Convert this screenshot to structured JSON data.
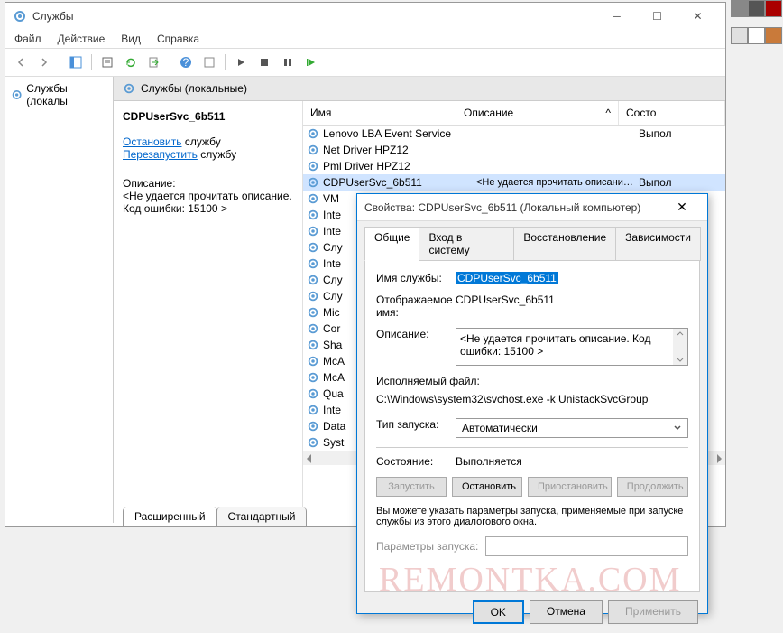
{
  "window": {
    "title": "Службы",
    "menu": {
      "file": "Файл",
      "action": "Действие",
      "view": "Вид",
      "help": "Справка"
    }
  },
  "tree": {
    "root": "Службы (локалы"
  },
  "panel_header": "Службы (локальные)",
  "detail": {
    "selected_name": "CDPUserSvc_6b511",
    "stop_link": "Остановить",
    "stop_suffix": " службу",
    "restart_link": "Перезапустить",
    "restart_suffix": " службу",
    "desc_label": "Описание:",
    "desc_text": "<Не удается прочитать описание. Код ошибки: 15100 >"
  },
  "columns": {
    "name": "Имя",
    "desc": "Описание",
    "status": "Состо"
  },
  "services": [
    {
      "name": "Lenovo LBA Event Service",
      "desc": "",
      "status": "Выпол"
    },
    {
      "name": "Net Driver HPZ12",
      "desc": "",
      "status": ""
    },
    {
      "name": "Pml Driver HPZ12",
      "desc": "",
      "status": ""
    },
    {
      "name": "CDPUserSvc_6b511",
      "desc": "<Не удается прочитать описание. Ко...",
      "status": "Выпол",
      "selected": true
    },
    {
      "name": "VM"
    },
    {
      "name": "Inte"
    },
    {
      "name": "Inte"
    },
    {
      "name": "Слу"
    },
    {
      "name": "Inte"
    },
    {
      "name": "Слу"
    },
    {
      "name": "Слу"
    },
    {
      "name": "Mic"
    },
    {
      "name": "Cor"
    },
    {
      "name": "Sha"
    },
    {
      "name": "McA"
    },
    {
      "name": "McA"
    },
    {
      "name": "Qua"
    },
    {
      "name": "Inte"
    },
    {
      "name": "Data"
    },
    {
      "name": "Syst"
    }
  ],
  "tabs": {
    "extended": "Расширенный",
    "standard": "Стандартный"
  },
  "dialog": {
    "title": "Свойства: CDPUserSvc_6b511 (Локальный компьютер)",
    "tabs": {
      "general": "Общие",
      "logon": "Вход в систему",
      "recovery": "Восстановление",
      "deps": "Зависимости"
    },
    "service_name_label": "Имя службы:",
    "service_name": "CDPUserSvc_6b511",
    "display_name_label": "Отображаемое имя:",
    "display_name": "CDPUserSvc_6b511",
    "desc_label": "Описание:",
    "desc_value": "<Не удается прочитать описание. Код ошибки: 15100 >",
    "exe_label": "Исполняемый файл:",
    "exe_path": "C:\\Windows\\system32\\svchost.exe -k UnistackSvcGroup",
    "startup_label": "Тип запуска:",
    "startup_value": "Автоматически",
    "state_label": "Состояние:",
    "state_value": "Выполняется",
    "buttons": {
      "start": "Запустить",
      "stop": "Остановить",
      "pause": "Приостановить",
      "resume": "Продолжить"
    },
    "help": "Вы можете указать параметры запуска, применяемые при запуске службы из этого диалогового окна.",
    "params_label": "Параметры запуска:",
    "ok": "OK",
    "cancel": "Отмена",
    "apply": "Применить"
  },
  "watermark": "REMONTKA.COM",
  "palette_colors": [
    "#888",
    "#555",
    "#a00",
    "#e0e0e0",
    "#fff",
    "#c97a3a"
  ]
}
